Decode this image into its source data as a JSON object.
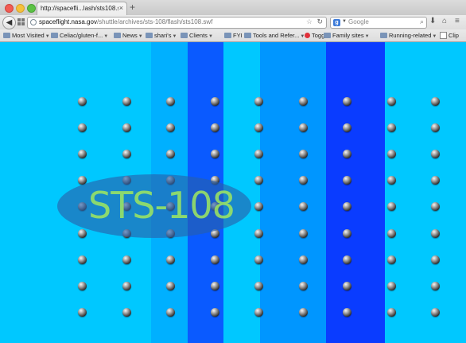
{
  "browser": {
    "tab": {
      "title": "http://spacefli...lash/sts108.swf",
      "close": "×"
    },
    "new_tab": "+",
    "url": {
      "host": "spaceflight.nasa.gov",
      "path": "/shuttle/archives/sts-108/flash/sts108.swf"
    },
    "search": {
      "engine_badge": "g",
      "placeholder": "Google"
    },
    "bookmarks": [
      {
        "label": "Most Visited",
        "icon": "folder-icon",
        "caret": true
      },
      {
        "label": "Celiac/gluten-f...",
        "icon": "folder-icon",
        "caret": true
      },
      {
        "label": "News",
        "icon": "folder-icon",
        "caret": true
      },
      {
        "label": "shari's",
        "icon": "folder-icon",
        "caret": true
      },
      {
        "label": "Clients",
        "icon": "folder-icon",
        "caret": true
      },
      {
        "label": "FYI",
        "icon": "folder-icon",
        "caret": true
      },
      {
        "label": "Tools and Refer...",
        "icon": "folder-icon",
        "caret": true
      },
      {
        "label": "Toggl",
        "icon": "toggl-icon",
        "caret": false
      },
      {
        "label": "Family sites",
        "icon": "folder-icon",
        "caret": true
      },
      {
        "label": "Running-related",
        "icon": "folder-icon",
        "caret": true
      },
      {
        "label": "Clip",
        "icon": "checkbox-icon",
        "caret": false
      }
    ]
  },
  "flash": {
    "title_text": "STS-108",
    "colors": {
      "background": "#00c8ff",
      "stripe_light": "#00b0ff",
      "stripe_mid": "#0096ff",
      "stripe_dark": "#0a5aff",
      "stripe_darkest": "#0a3cff",
      "oval": "#285faa",
      "title": "#9fe860"
    }
  }
}
